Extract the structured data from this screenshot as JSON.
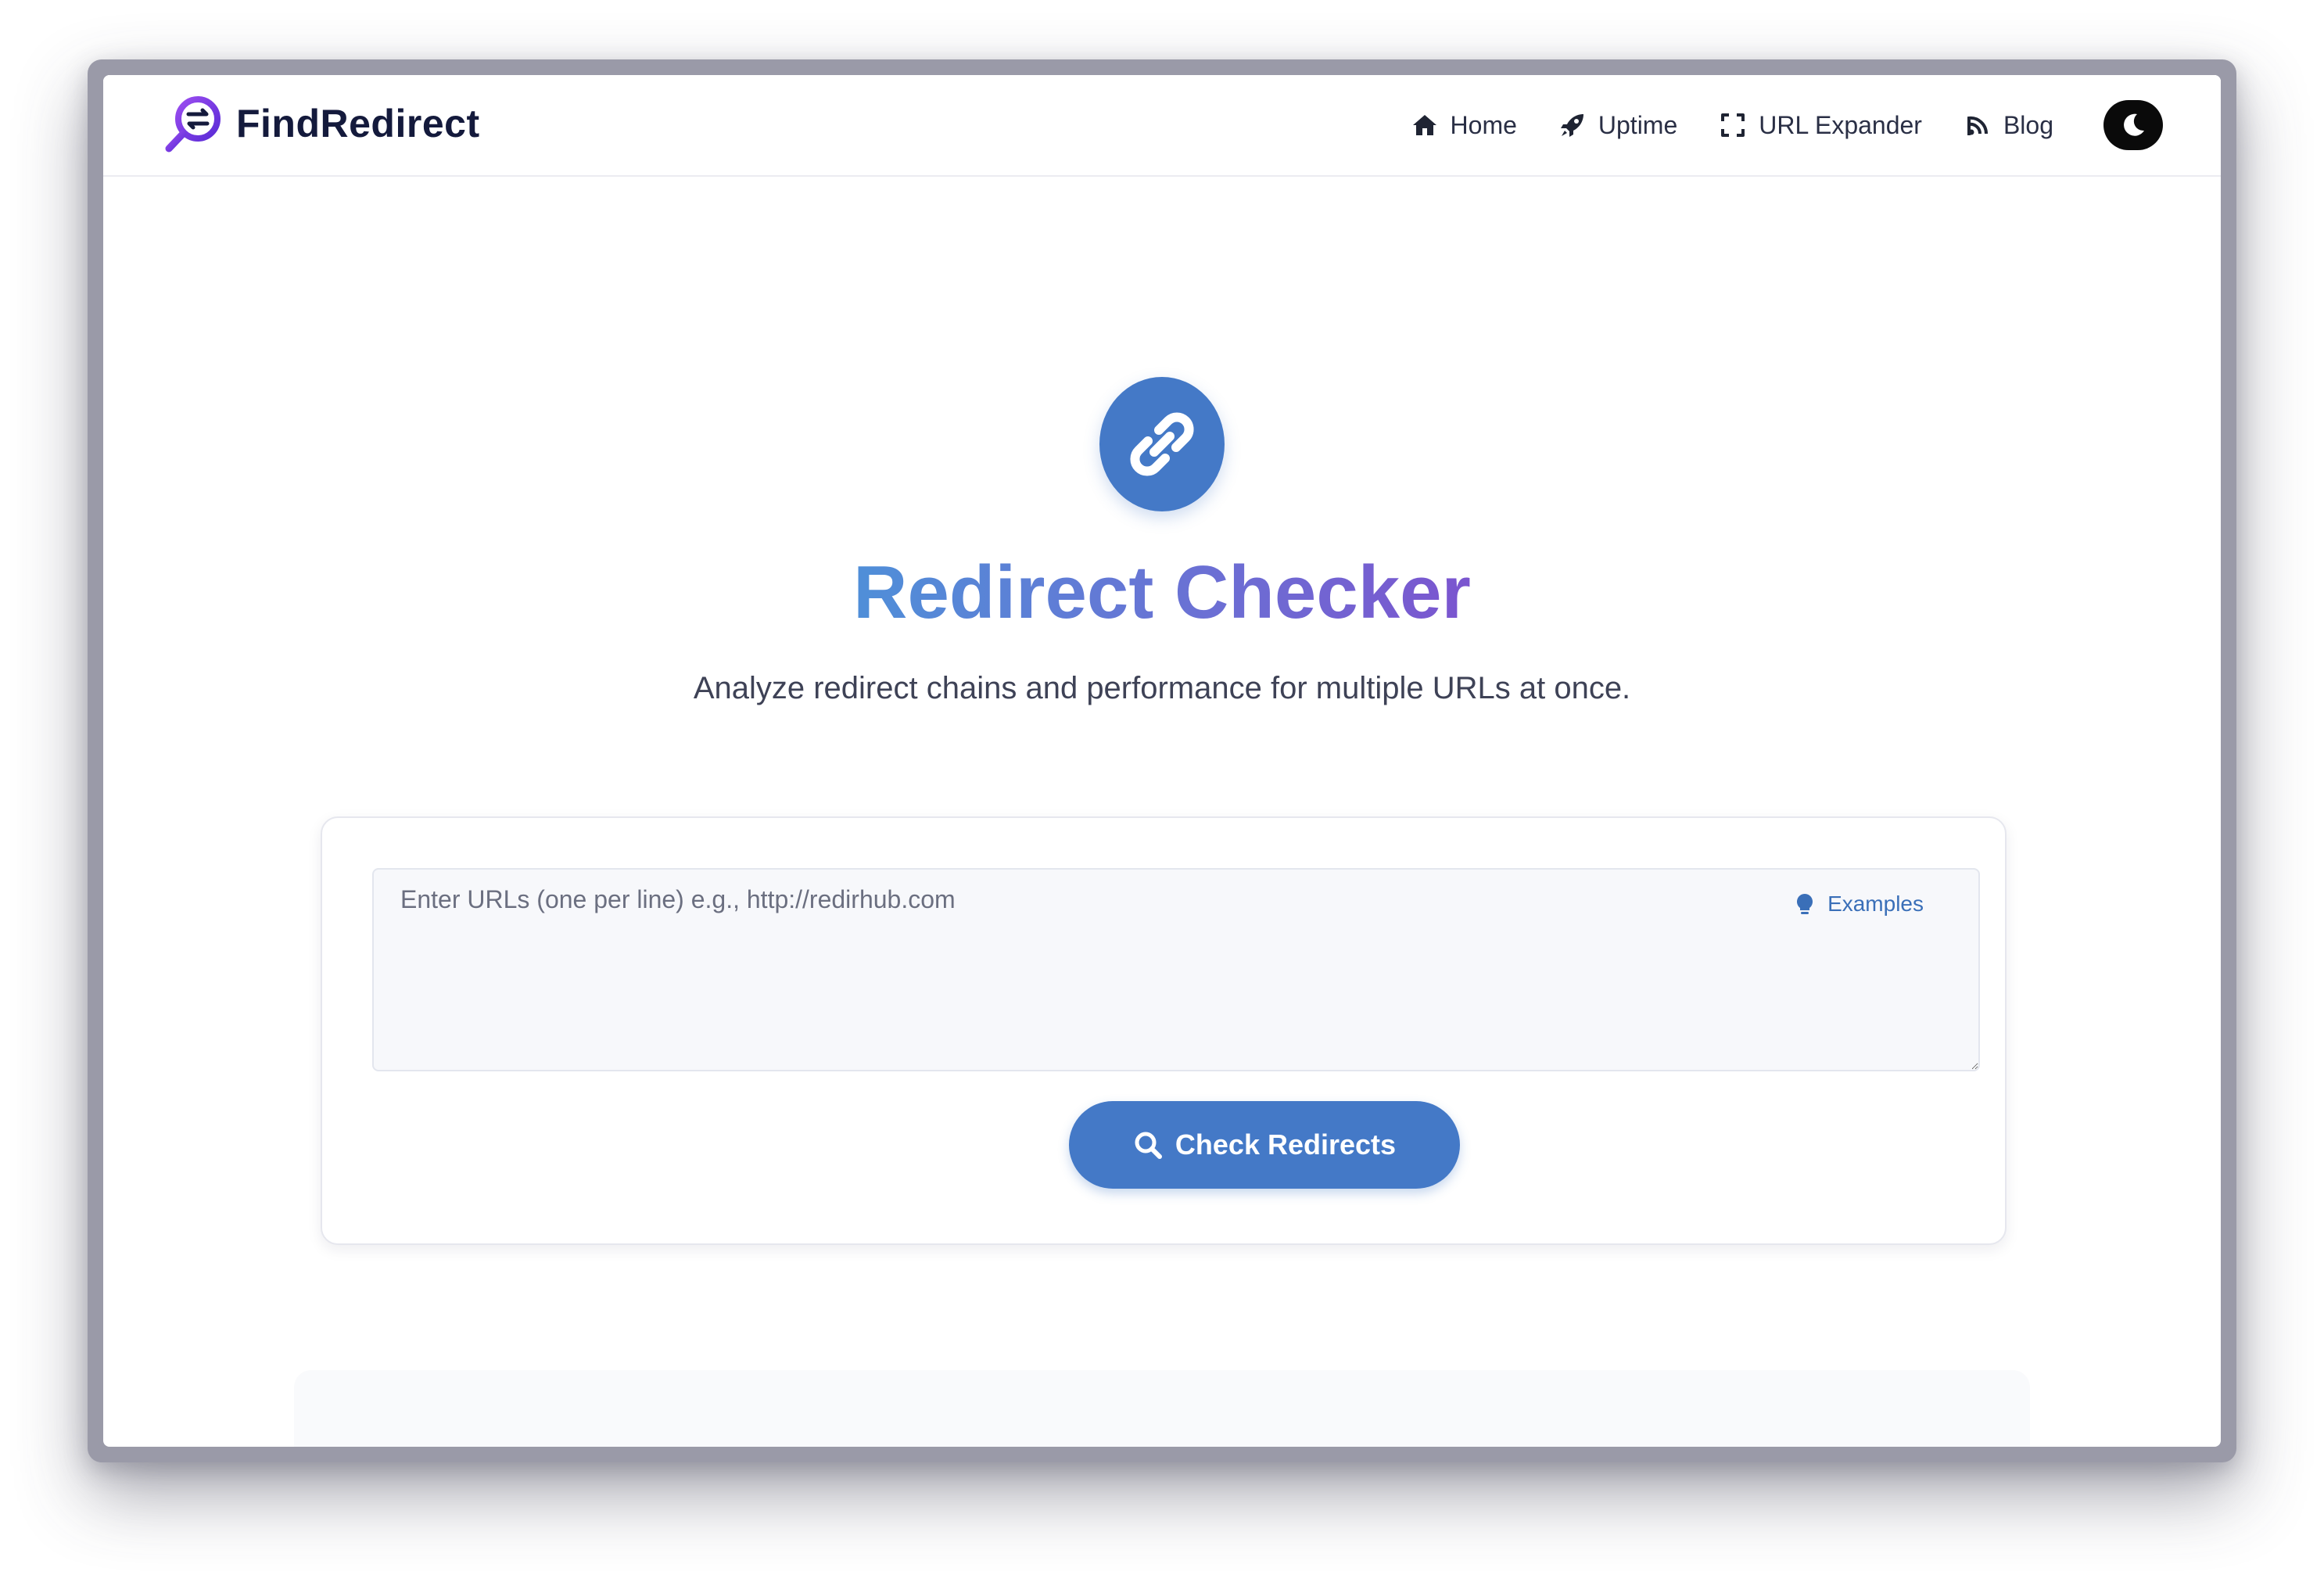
{
  "brand": {
    "name": "FindRedirect",
    "logo_icon": "magnifier-arrows-logo-icon",
    "colors": {
      "text": "#141a3c",
      "accent": "#7b3fe4"
    }
  },
  "nav": {
    "items": [
      {
        "label": "Home",
        "icon": "home-icon"
      },
      {
        "label": "Uptime",
        "icon": "rocket-icon"
      },
      {
        "label": "URL Expander",
        "icon": "expand-icon"
      },
      {
        "label": "Blog",
        "icon": "feed-icon"
      }
    ],
    "theme_toggle_icon": "moon-icon"
  },
  "hero": {
    "icon": "link-icon",
    "title": "Redirect Checker",
    "subtitle": "Analyze redirect chains and performance for multiple URLs at once.",
    "title_gradient": [
      "#4f8fd8",
      "#7b55cf"
    ]
  },
  "form": {
    "placeholder": "Enter URLs (one per line) e.g., http://redirhub.com",
    "value": "",
    "examples_label": "Examples",
    "examples_icon": "lightbulb-icon",
    "submit_label": "Check Redirects",
    "submit_icon": "search-icon",
    "primary_color": "#4479c7"
  }
}
